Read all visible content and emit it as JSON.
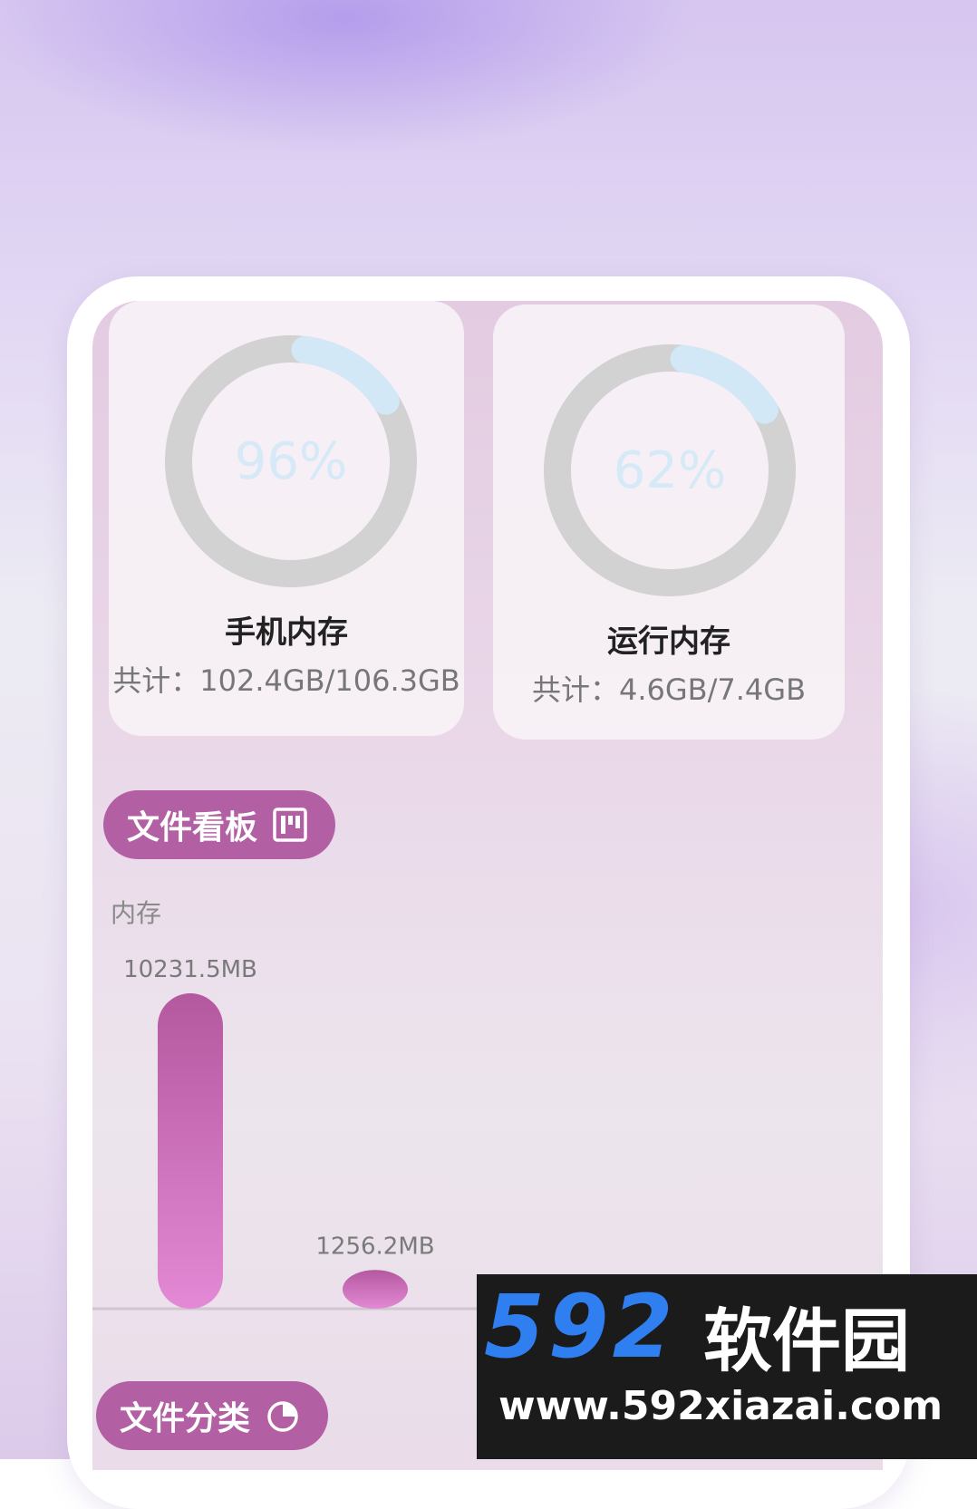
{
  "storage_cards": [
    {
      "percent_text": "96%",
      "percent": 96,
      "title": "手机内存",
      "total_text": "共计：102.4GB/106.3GB"
    },
    {
      "percent_text": "62%",
      "percent": 62,
      "title": "运行内存",
      "total_text": "共计：4.6GB/7.4GB"
    }
  ],
  "file_board": {
    "label": "文件看板",
    "icon": "board-icon"
  },
  "memory_label": "内存",
  "chart_data": {
    "type": "bar",
    "title": "",
    "ylabel": "内存",
    "categories": [
      "",
      "",
      ""
    ],
    "values": [
      10231.5,
      1256.2,
      0
    ],
    "value_labels": [
      "10231.5MB",
      "1256.2MB",
      ""
    ],
    "ylim": [
      0,
      10231.5
    ],
    "grid": false,
    "bar_color_top": "#b4589f",
    "bar_color_bottom": "#e389d5"
  },
  "file_category": {
    "label": "文件分类",
    "icon": "pie-chart-icon"
  },
  "watermark": {
    "number": "592",
    "name": "软件园",
    "url": "www.592xiazai.com"
  },
  "colors": {
    "accent": "#b25fa3",
    "ring_track": "#d2d2d2",
    "ring_progress": "#d2e8f6"
  }
}
